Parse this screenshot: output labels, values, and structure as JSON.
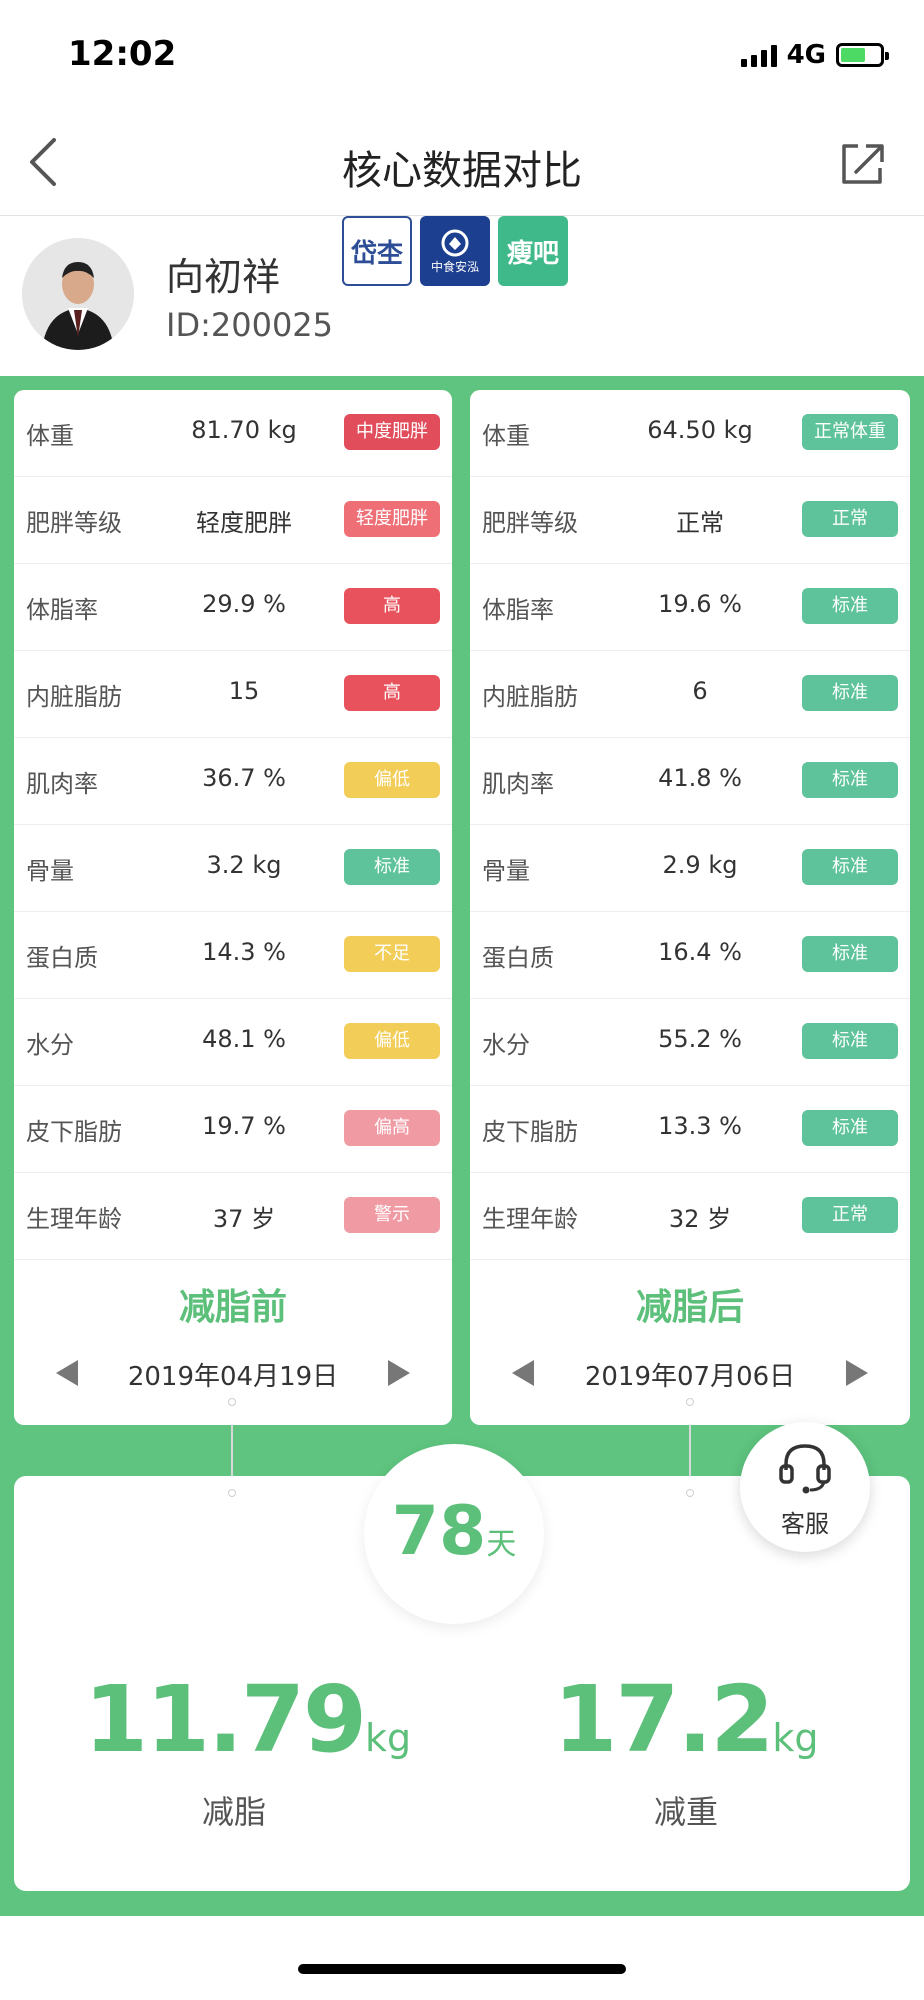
{
  "status": {
    "time": "12:02",
    "network": "4G"
  },
  "nav": {
    "title": "核心数据对比"
  },
  "profile": {
    "name": "向初祥",
    "id": "ID:200025",
    "logos": [
      "pz-logo",
      "food-safety-logo",
      "shouba-logo"
    ],
    "logo_texts": [
      "岱杢",
      "中食安泓",
      "瘦吧"
    ]
  },
  "before": {
    "rows": [
      {
        "label": "体重",
        "value": "81.70 kg",
        "status": "中度肥胖",
        "color": "#e14d5b"
      },
      {
        "label": "肥胖等级",
        "value": "轻度肥胖",
        "status": "轻度肥胖",
        "color": "#ef6f77"
      },
      {
        "label": "体脂率",
        "value": "29.9 %",
        "status": "高",
        "color": "#e8525d"
      },
      {
        "label": "内脏脂肪",
        "value": "15",
        "status": "高",
        "color": "#e8525d"
      },
      {
        "label": "肌肉率",
        "value": "36.7 %",
        "status": "偏低",
        "color": "#f2cd58"
      },
      {
        "label": "骨量",
        "value": "3.2 kg",
        "status": "标准",
        "color": "#5ec39a"
      },
      {
        "label": "蛋白质",
        "value": "14.3 %",
        "status": "不足",
        "color": "#f2cd58"
      },
      {
        "label": "水分",
        "value": "48.1 %",
        "status": "偏低",
        "color": "#f2cd58"
      },
      {
        "label": "皮下脂肪",
        "value": "19.7 %",
        "status": "偏高",
        "color": "#f09aa3"
      },
      {
        "label": "生理年龄",
        "value": "37 岁",
        "status": "警示",
        "color": "#f09aa3"
      }
    ],
    "caption": "减脂前",
    "date": "2019年04月19日"
  },
  "after": {
    "rows": [
      {
        "label": "体重",
        "value": "64.50 kg",
        "status": "正常体重",
        "color": "#5ec39a"
      },
      {
        "label": "肥胖等级",
        "value": "正常",
        "status": "正常",
        "color": "#5ec39a"
      },
      {
        "label": "体脂率",
        "value": "19.6 %",
        "status": "标准",
        "color": "#5ec39a"
      },
      {
        "label": "内脏脂肪",
        "value": "6",
        "status": "标准",
        "color": "#5ec39a"
      },
      {
        "label": "肌肉率",
        "value": "41.8 %",
        "status": "标准",
        "color": "#5ec39a"
      },
      {
        "label": "骨量",
        "value": "2.9 kg",
        "status": "标准",
        "color": "#5ec39a"
      },
      {
        "label": "蛋白质",
        "value": "16.4 %",
        "status": "标准",
        "color": "#5ec39a"
      },
      {
        "label": "水分",
        "value": "55.2 %",
        "status": "标准",
        "color": "#5ec39a"
      },
      {
        "label": "皮下脂肪",
        "value": "13.3 %",
        "status": "标准",
        "color": "#5ec39a"
      },
      {
        "label": "生理年龄",
        "value": "32 岁",
        "status": "正常",
        "color": "#5ec39a"
      }
    ],
    "caption": "减脂后",
    "date": "2019年07月06日"
  },
  "summary": {
    "days": "78",
    "days_unit": "天",
    "fat_loss": "11.79",
    "fat_unit": "kg",
    "fat_label": "减脂",
    "weight_loss": "17.2",
    "weight_unit": "kg",
    "weight_label": "减重"
  },
  "service": {
    "label": "客服",
    "icon": "headset-icon"
  },
  "colors": {
    "accent_green": "#5ec47f",
    "text_green": "#5cbf7a"
  }
}
